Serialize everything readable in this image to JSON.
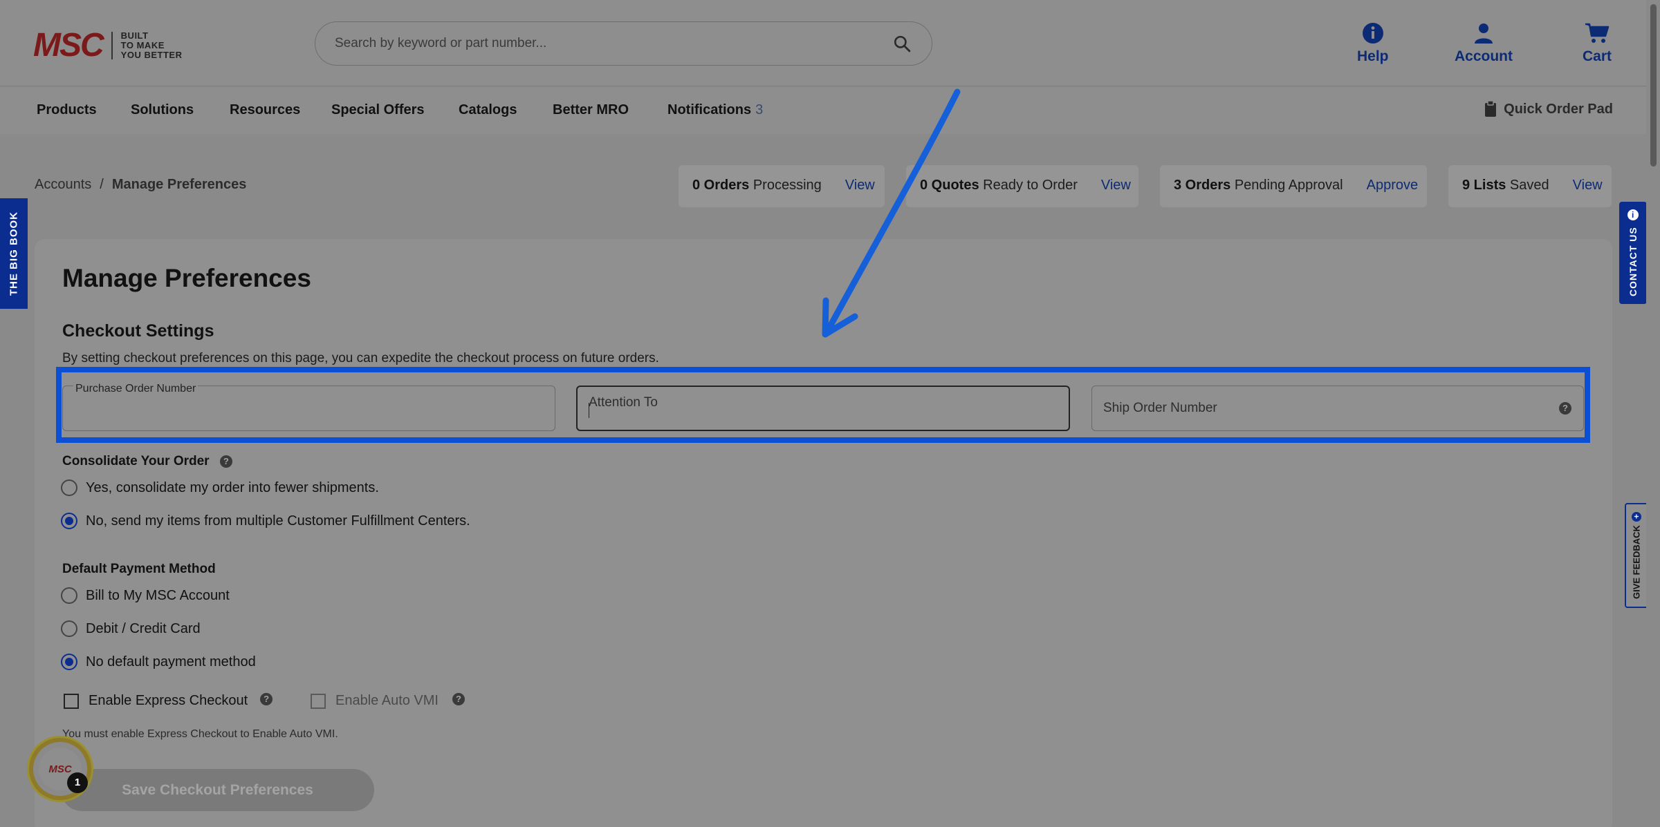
{
  "header": {
    "logo_text": "MSC",
    "logo_tagline": [
      "BUILT",
      "TO MAKE",
      "YOU BETTER"
    ],
    "search_placeholder": "Search by keyword or part number...",
    "help_label": "Help",
    "account_label": "Account",
    "cart_label": "Cart"
  },
  "nav": {
    "items": [
      "Products",
      "Solutions",
      "Resources",
      "Special Offers",
      "Catalogs",
      "Better MRO",
      "Notifications"
    ],
    "notifications_count": "3",
    "quick_order_label": "Quick Order Pad"
  },
  "breadcrumb": {
    "parent": "Accounts",
    "separator": "/",
    "current": "Manage Preferences"
  },
  "status_cards": [
    {
      "bold": "0 Orders",
      "text": "Processing",
      "link": "View"
    },
    {
      "bold": "0 Quotes",
      "text": "Ready to Order",
      "link": "View"
    },
    {
      "bold": "3 Orders",
      "text": "Pending Approval",
      "link": "Approve"
    },
    {
      "bold": "9 Lists",
      "text": "Saved",
      "link": "View"
    }
  ],
  "side_tabs": {
    "big_book": "THE BIG BOOK",
    "contact_us": "CONTACT US",
    "give_feedback": "GIVE FEEDBACK"
  },
  "main": {
    "page_title": "Manage Preferences",
    "section_title": "Checkout Settings",
    "section_desc": "By setting checkout preferences on this page, you can expedite the checkout process on future orders.",
    "fields": {
      "po_label": "Purchase Order Number",
      "attention_placeholder": "Attention To",
      "ship_order_placeholder": "Ship Order Number"
    },
    "consolidate": {
      "title": "Consolidate Your Order",
      "options": [
        {
          "label": "Yes, consolidate my order into fewer shipments.",
          "checked": false
        },
        {
          "label": "No, send my items from multiple Customer Fulfillment Centers.",
          "checked": true
        }
      ]
    },
    "payment": {
      "title": "Default Payment Method",
      "options": [
        {
          "label": "Bill to My MSC Account",
          "checked": false
        },
        {
          "label": "Debit / Credit Card",
          "checked": false
        },
        {
          "label": "No default payment method",
          "checked": true
        }
      ]
    },
    "express_checkout_label": "Enable Express Checkout",
    "auto_vmi_label": "Enable Auto VMI",
    "note": "You must enable Express Checkout to Enable Auto VMI.",
    "save_button": "Save Checkout Preferences"
  },
  "chat": {
    "logo": "MSC",
    "count": "1"
  },
  "colors": {
    "brand_blue": "#0b2d8f",
    "highlight_blue": "#0b4fd4",
    "annotation_arrow": "#1560d8"
  }
}
